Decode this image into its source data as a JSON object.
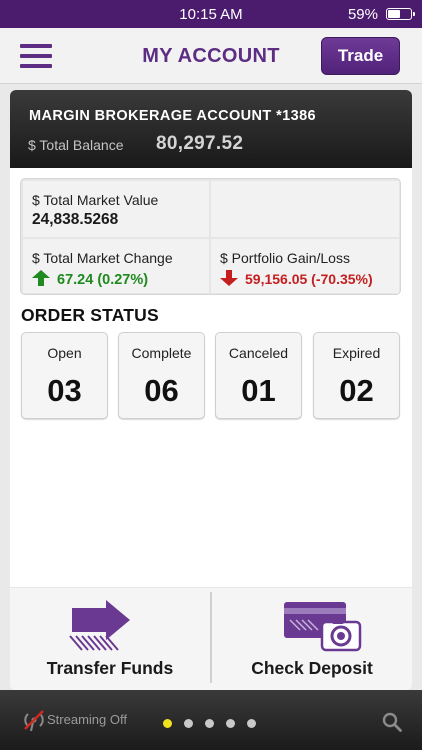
{
  "status_bar": {
    "time": "10:15 AM",
    "battery_percent": "59%",
    "battery_level": 0.59
  },
  "nav": {
    "title": "MY ACCOUNT",
    "trade_label": "Trade"
  },
  "account": {
    "name": "MARGIN BROKERAGE ACCOUNT *1386",
    "balance_label": "$ Total Balance",
    "balance_value": "80,297.52"
  },
  "summary": {
    "market_value_label": "$ Total Market Value",
    "market_value": "24,838.5268",
    "market_change_label": "$ Total Market Change",
    "market_change": "67.24 (0.27%)",
    "gain_loss_label": "$ Portfolio Gain/Loss",
    "gain_loss": "59,156.05 (-70.35%)"
  },
  "order_status": {
    "heading": "ORDER STATUS",
    "items": [
      {
        "label": "Open",
        "count": "03"
      },
      {
        "label": "Complete",
        "count": "06"
      },
      {
        "label": "Canceled",
        "count": "01"
      },
      {
        "label": "Expired",
        "count": "02"
      }
    ]
  },
  "actions": {
    "transfer_label": "Transfer Funds",
    "deposit_label": "Check Deposit"
  },
  "bottom_bar": {
    "streaming_label": "Streaming Off",
    "page_count": 5,
    "active_page": 1
  },
  "colors": {
    "brand_purple": "#5c2d83",
    "status_bar": "#4b1b6d",
    "gain_green": "#1f8a1f",
    "loss_red": "#c41e1e",
    "active_dot": "#f1e21f"
  },
  "icons": [
    "menu-icon",
    "battery-icon",
    "up-arrow-icon",
    "down-arrow-icon",
    "transfer-arrow-icon",
    "check-deposit-icon",
    "streaming-off-icon",
    "search-icon"
  ]
}
